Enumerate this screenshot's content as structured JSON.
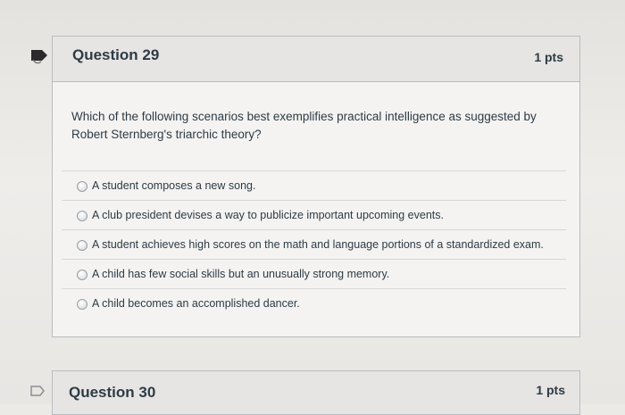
{
  "question_29": {
    "title": "Question 29",
    "points": "1 pts",
    "text": "Which of the following scenarios best exemplifies practical intelligence as suggested by Robert Sternberg's triarchic theory?",
    "answers": [
      "A student composes a new song.",
      "A club president devises a way to publicize important upcoming events.",
      "A student achieves high scores on the math and language portions of a standardized exam.",
      "A child has few social skills but an unusually strong memory.",
      "A child becomes an accomplished dancer."
    ],
    "flag_icon": "flag-icon",
    "flag_color": "#2d2d2d"
  },
  "question_30": {
    "title": "Question 30",
    "points": "1 pts",
    "flag_icon": "flag-outline-icon"
  }
}
